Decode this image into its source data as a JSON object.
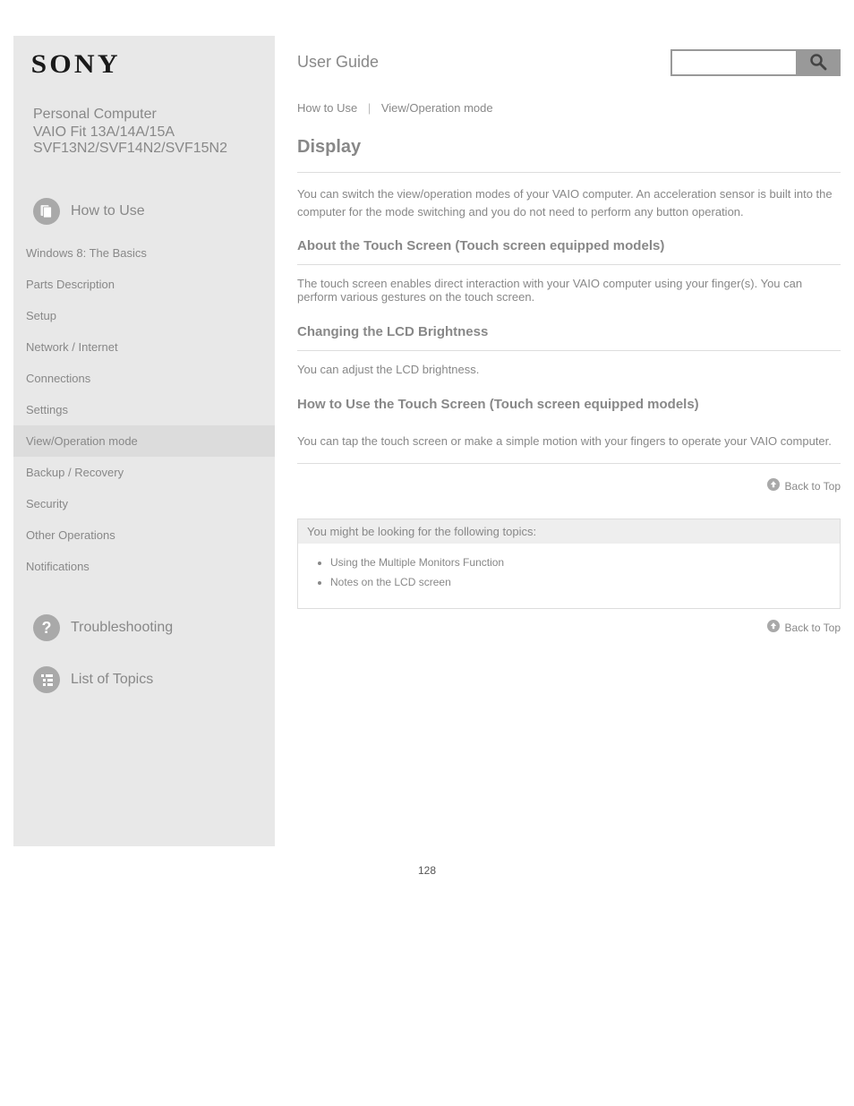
{
  "brand": "SONY",
  "product": "Personal Computer",
  "model": "VAIO Fit 13A/14A/15A SVF13N2/SVF14N2/SVF15N2",
  "user_guide_label": "User Guide",
  "search": {
    "placeholder": ""
  },
  "sidebar": {
    "group_main": "How to Use",
    "items": [
      "Windows 8: The Basics",
      "Parts Description",
      "Setup",
      "Network / Internet",
      "Connections",
      "Settings",
      "View/Operation mode",
      "Backup / Recovery",
      "Security",
      "Other Operations",
      "Notifications"
    ],
    "active_index": 6,
    "group_troubleshoot": "Troubleshooting",
    "group_list": "List of Topics"
  },
  "breadcrumb": {
    "a": "How to Use",
    "b": "View/Operation mode"
  },
  "page_title": "Display",
  "intro": "You can switch the view/operation modes of your VAIO computer. An acceleration sensor is built into the computer for the mode switching and you do not need to perform any button operation.",
  "sections": [
    {
      "title": "About the Touch Screen (Touch screen equipped models)",
      "items": [
        "The touch screen enables direct interaction with your VAIO computer using your finger(s). You can perform various gestures on the touch screen."
      ]
    },
    {
      "title": "Changing the LCD Brightness",
      "items": [
        "You can adjust the LCD brightness."
      ]
    },
    {
      "title": "How to Use the Touch Screen (Touch screen equipped models)",
      "items": [
        "You can tap the touch screen or make a simple motion with your fingers to operate your VAIO computer."
      ]
    }
  ],
  "back_to_top": "Back to Top",
  "related": {
    "title": "You might be looking for the following topics:",
    "links": [
      "Using the Multiple Monitors Function",
      "Notes on the LCD screen"
    ]
  },
  "page_number": "128"
}
